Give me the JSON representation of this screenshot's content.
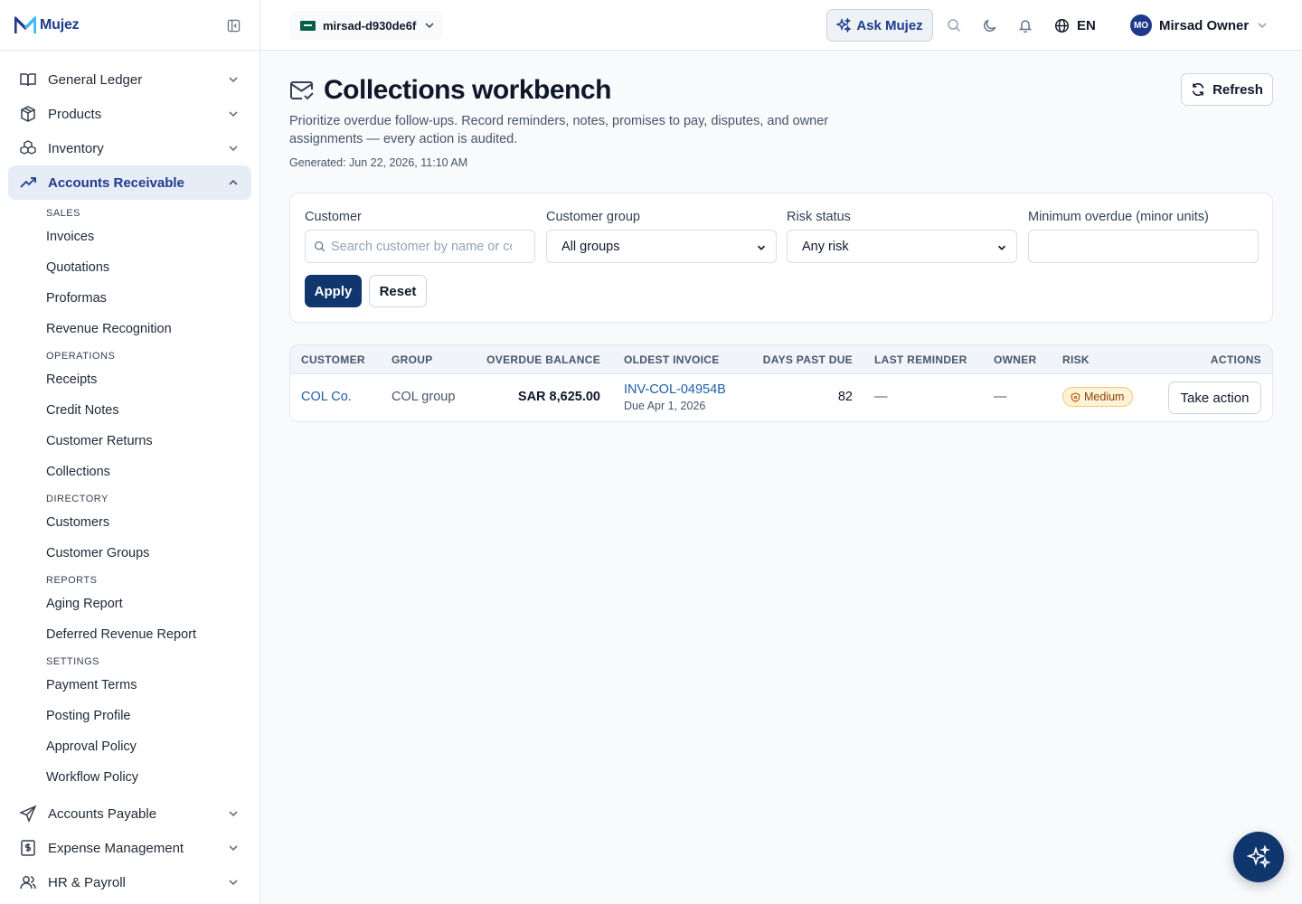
{
  "brand": {
    "name": "Mujez"
  },
  "sidebar": {
    "top_items": [
      {
        "label": "General Ledger"
      },
      {
        "label": "Products"
      },
      {
        "label": "Inventory"
      },
      {
        "label": "Accounts Receivable"
      }
    ],
    "ar_sections": [
      {
        "heading": "SALES",
        "items": [
          "Invoices",
          "Quotations",
          "Proformas",
          "Revenue Recognition"
        ]
      },
      {
        "heading": "OPERATIONS",
        "items": [
          "Receipts",
          "Credit Notes",
          "Customer Returns",
          "Collections"
        ]
      },
      {
        "heading": "DIRECTORY",
        "items": [
          "Customers",
          "Customer Groups"
        ]
      },
      {
        "heading": "REPORTS",
        "items": [
          "Aging Report",
          "Deferred Revenue Report"
        ]
      },
      {
        "heading": "SETTINGS",
        "items": [
          "Payment Terms",
          "Posting Profile",
          "Approval Policy",
          "Workflow Policy"
        ]
      }
    ],
    "bottom_items": [
      {
        "label": "Accounts Payable"
      },
      {
        "label": "Expense Management"
      },
      {
        "label": "HR & Payroll"
      }
    ]
  },
  "topbar": {
    "company": "mirsad-d930de6f",
    "ask_label": "Ask Mujez",
    "language": "EN",
    "user_initials": "MO",
    "user_name": "Mirsad Owner"
  },
  "page": {
    "title": "Collections workbench",
    "description": "Prioritize overdue follow-ups. Record reminders, notes, promises to pay, disputes, and owner assignments — every action is audited.",
    "generated": "Generated: Jun 22, 2026, 11:10 AM",
    "refresh_label": "Refresh"
  },
  "filters": {
    "customer_label": "Customer",
    "customer_placeholder": "Search customer by name or code",
    "group_label": "Customer group",
    "group_value": "All groups",
    "risk_label": "Risk status",
    "risk_value": "Any risk",
    "min_overdue_label": "Minimum overdue (minor units)",
    "min_overdue_value": "",
    "apply_label": "Apply",
    "reset_label": "Reset"
  },
  "table": {
    "headers": [
      "CUSTOMER",
      "GROUP",
      "OVERDUE BALANCE",
      "OLDEST INVOICE",
      "DAYS PAST DUE",
      "LAST REMINDER",
      "OWNER",
      "RISK",
      "ACTIONS"
    ],
    "rows": [
      {
        "customer": "COL Co.",
        "group": "COL group",
        "overdue_balance": "SAR 8,625.00",
        "oldest_invoice": "INV-COL-04954B",
        "due_date": "Due Apr 1, 2026",
        "days_past_due": "82",
        "last_reminder": "—",
        "owner": "—",
        "risk": "Medium",
        "action_label": "Take action"
      }
    ]
  },
  "colors": {
    "primary": "#10366e",
    "link": "#1d5fa8",
    "risk_medium_bg": "#fdf3d6",
    "risk_medium_text": "#92400e"
  }
}
